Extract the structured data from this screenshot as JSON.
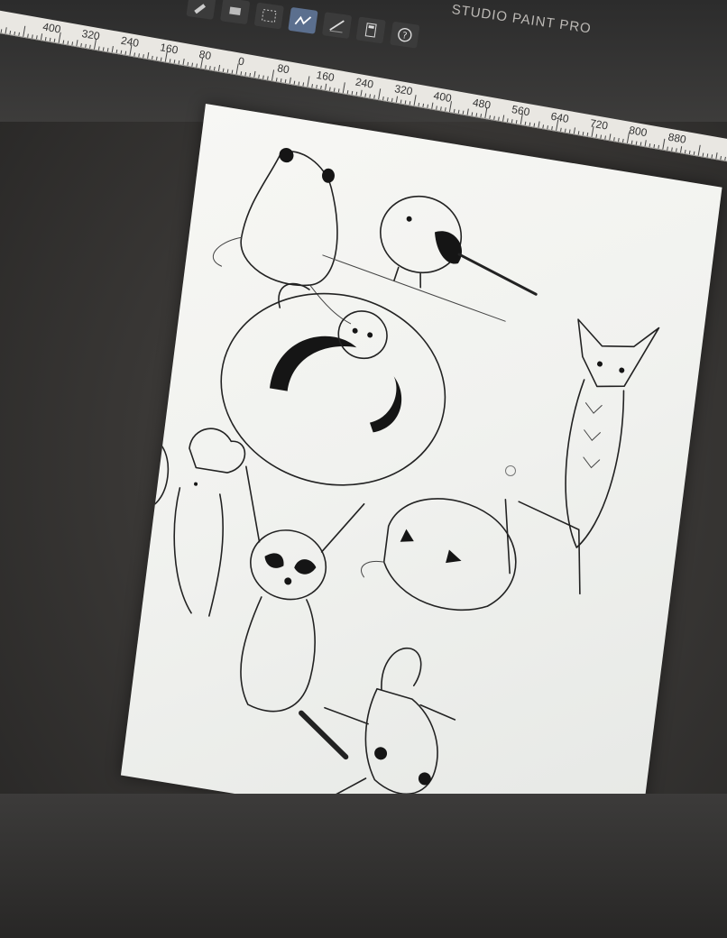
{
  "app": {
    "title": "STUDIO PAINT PRO"
  },
  "toolbar": {
    "tools": [
      {
        "name": "brush-tool",
        "icon": "brush-icon",
        "active": false
      },
      {
        "name": "eraser-tool",
        "icon": "eraser-icon",
        "active": false
      },
      {
        "name": "select-tool",
        "icon": "marquee-icon",
        "active": false
      },
      {
        "name": "pen-tool",
        "icon": "pen-stroke-icon",
        "active": true
      },
      {
        "name": "line-tool",
        "icon": "line-icon",
        "active": false
      },
      {
        "name": "layers-tool",
        "icon": "layers-icon",
        "active": false
      },
      {
        "name": "help-tool",
        "icon": "help-icon",
        "active": false
      }
    ]
  },
  "ruler": {
    "labels": [
      "400",
      "320",
      "240",
      "160",
      "80",
      "0",
      "80",
      "160",
      "240",
      "320",
      "400",
      "480",
      "560",
      "640",
      "720",
      "800",
      "880"
    ]
  },
  "canvas": {
    "sketches": [
      "frog-sketch",
      "long-tailed-tit-sketch",
      "owl-sketch",
      "snake-sketch",
      "chef-mouse-sketch",
      "raccoon-sketch",
      "blob-fish-sketch",
      "gecko-sketch"
    ]
  },
  "colors": {
    "accent": "#5b6f8e",
    "canvas_bg": "#f3f4f1",
    "ink": "#222222"
  }
}
